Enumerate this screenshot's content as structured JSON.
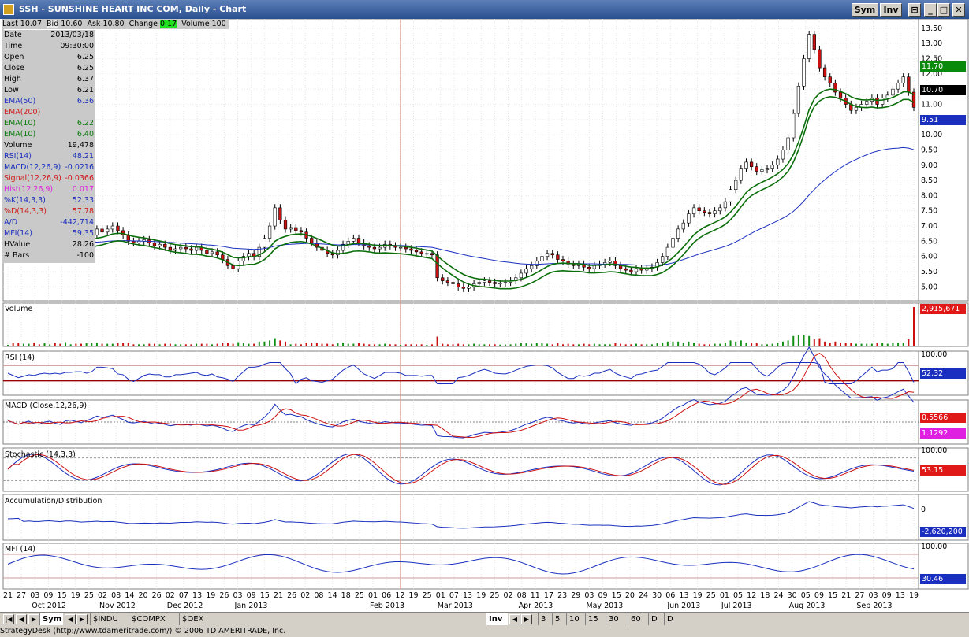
{
  "window": {
    "title": "SSH - SUNSHINE HEART INC COM, Daily - Chart",
    "sym_btn": "Sym",
    "inv_btn": "Inv"
  },
  "quote": {
    "last_label": "Last",
    "last": "10.07",
    "bid_label": "Bid",
    "bid": "10.60",
    "ask_label": "Ask",
    "ask": "10.80",
    "change_label": "Change",
    "change": "0.17",
    "volume_label": "Volume",
    "volume": "100"
  },
  "info_rows": [
    {
      "label": "Date",
      "value": "2013/03/18",
      "color": "#000000"
    },
    {
      "label": "Time",
      "value": "09:30:00",
      "color": "#000000"
    },
    {
      "label": "Open",
      "value": "6.25",
      "color": "#000000"
    },
    {
      "label": "Close",
      "value": "6.25",
      "color": "#000000"
    },
    {
      "label": "High",
      "value": "6.37",
      "color": "#000000"
    },
    {
      "label": "Low",
      "value": "6.21",
      "color": "#000000"
    },
    {
      "label": "EMA(50)",
      "value": "6.36",
      "color": "#1a2fbf"
    },
    {
      "label": "EMA(200)",
      "value": "",
      "color": "#d01818"
    },
    {
      "label": "EMA(10)",
      "value": "6.22",
      "color": "#0a7a0a"
    },
    {
      "label": "EMA(10)",
      "value": "6.40",
      "color": "#0a7a0a"
    },
    {
      "label": "Volume",
      "value": "19,478",
      "color": "#000000"
    },
    {
      "label": "RSI(14)",
      "value": "48.21",
      "color": "#1a2fbf"
    },
    {
      "label": "MACD(12,26,9)",
      "value": "-0.0216",
      "color": "#1a2fbf"
    },
    {
      "label": "Signal(12,26,9)",
      "value": "-0.0366",
      "color": "#d01818"
    },
    {
      "label": "Hist(12,26,9)",
      "value": "0.017",
      "color": "#e020e0"
    },
    {
      "label": "%K(14,3,3)",
      "value": "52.33",
      "color": "#1a2fbf"
    },
    {
      "label": "%D(14,3,3)",
      "value": "57.78",
      "color": "#d01818"
    },
    {
      "label": "A/D",
      "value": "-442,714",
      "color": "#1a2fbf"
    },
    {
      "label": "MFI(14)",
      "value": "59.35",
      "color": "#1a2fbf"
    },
    {
      "label": "HValue",
      "value": "28.26",
      "color": "#000000"
    },
    {
      "label": "# Bars",
      "value": "-100",
      "color": "#000000"
    }
  ],
  "panels": {
    "volume_label": "Volume",
    "rsi_label": "RSI (14)",
    "macd_label": "MACD (Close,12,26,9)",
    "stoch_label": "Stochastic (14,3,3)",
    "ad_label": "Accumulation/Distribution",
    "mfi_label": "MFI (14)"
  },
  "value_tags": {
    "price_1": "11.70",
    "price_2": "10.70",
    "ema50": "9.51",
    "volume": "2,915,671",
    "rsi": "52.32",
    "macd": "0.5566",
    "signal": "1.1292",
    "stoch": "53.15",
    "ad": "-2,620,200",
    "mfi": "30.46"
  },
  "colors": {
    "price_1_bg": "#0a8a0a",
    "price_2_bg": "#000000",
    "ema50_bg": "#1a2fbf",
    "volume_bg": "#e01818",
    "rsi_bg": "#1a2fbf",
    "macd_bg": "#e01818",
    "signal_bg": "#e020e0",
    "stoch_bg": "#e01818",
    "ad_bg": "#1a2fbf",
    "mfi_bg": "#1a2fbf",
    "up_candle": "#ffffff",
    "down_candle": "#cc1010",
    "ema50": "#1a2fbf",
    "ema10": "#0a6e0a",
    "vol_up": "#109010",
    "vol_down": "#cc1010",
    "cursor": "#e05050"
  },
  "tabs": {
    "sym": "Sym",
    "t1": "$INDU",
    "t2": "$COMPX",
    "t3": "$OEX",
    "inv": "Inv",
    "p1": "3",
    "p2": "5",
    "p3": "10",
    "p4": "15",
    "p5": "30",
    "p6": "60",
    "p7": "D",
    "p8": "D"
  },
  "status": "StrategyDesk (http://www.tdameritrade.com/)  © 2006 TD AMERITRADE, Inc.",
  "chart_data": {
    "type": "line",
    "title": "SSH - SUNSHINE HEART INC COM, Daily - Chart",
    "xlabel": "",
    "ylabel": "",
    "ylim": [
      4.75,
      13.6
    ],
    "y_ticks": [
      "13.50",
      "13.00",
      "12.50",
      "12.00",
      "11.50",
      "11.00",
      "10.50",
      "10.00",
      "9.50",
      "9.00",
      "8.50",
      "8.00",
      "7.50",
      "7.00",
      "6.50",
      "6.00",
      "5.50",
      "5.00"
    ],
    "day_ticks": [
      "21",
      "27",
      "03",
      "09",
      "15",
      "19",
      "25",
      "02",
      "08",
      "14",
      "20",
      "26",
      "02",
      "07",
      "13",
      "19",
      "26",
      "03",
      "09",
      "15",
      "21",
      "26",
      "02",
      "08",
      "14",
      "18",
      "25",
      "01",
      "06",
      "12",
      "19",
      "25",
      "01",
      "07",
      "13",
      "19",
      "25",
      "02",
      "08",
      "11",
      "17",
      "23",
      "29",
      "03",
      "09",
      "15",
      "20",
      "24",
      "30",
      "06",
      "13",
      "19",
      "25",
      "01",
      "05",
      "12",
      "18",
      "24",
      "30",
      "05",
      "09",
      "15",
      "21",
      "27",
      "03",
      "09",
      "13",
      "19"
    ],
    "month_labels": [
      "Oct 2012",
      "Nov 2012",
      "Dec 2012",
      "Jan 2013",
      "Feb 2013",
      "Mar 2013",
      "Apr 2013",
      "May 2013",
      "Jun 2013",
      "Jul 2013",
      "Aug 2013",
      "Sep 2013"
    ],
    "month_tick_index": [
      2,
      7,
      12,
      17,
      27,
      32,
      38,
      43,
      49,
      53,
      58,
      63
    ],
    "price_close": [
      6.7,
      6.55,
      6.4,
      6.5,
      6.6,
      6.4,
      6.35,
      6.5,
      6.55,
      6.4,
      6.3,
      6.55,
      6.6,
      6.5,
      6.4,
      6.55,
      6.7,
      6.9,
      6.8,
      6.9,
      7.0,
      6.85,
      6.7,
      6.5,
      6.45,
      6.5,
      6.55,
      6.45,
      6.35,
      6.4,
      6.3,
      6.2,
      6.25,
      6.3,
      6.25,
      6.2,
      6.3,
      6.2,
      6.1,
      6.15,
      6.05,
      5.9,
      5.7,
      5.6,
      5.85,
      6.0,
      6.1,
      6.0,
      6.3,
      6.6,
      7.0,
      7.6,
      7.2,
      6.9,
      6.95,
      6.85,
      6.8,
      6.6,
      6.45,
      6.3,
      6.2,
      6.1,
      6.05,
      6.2,
      6.4,
      6.5,
      6.6,
      6.45,
      6.35,
      6.3,
      6.25,
      6.3,
      6.4,
      6.35,
      6.3,
      6.3,
      6.25,
      6.2,
      6.15,
      6.1,
      6.1,
      6.05,
      5.3,
      5.2,
      5.15,
      5.1,
      5.0,
      4.95,
      5.0,
      5.1,
      5.15,
      5.2,
      5.15,
      5.1,
      5.12,
      5.15,
      5.2,
      5.3,
      5.45,
      5.6,
      5.7,
      5.85,
      6.0,
      6.1,
      6.05,
      5.9,
      5.85,
      5.75,
      5.7,
      5.75,
      5.65,
      5.6,
      5.7,
      5.75,
      5.8,
      5.85,
      5.7,
      5.6,
      5.55,
      5.5,
      5.6,
      5.55,
      5.6,
      5.65,
      5.8,
      6.0,
      6.3,
      6.6,
      6.9,
      7.1,
      7.4,
      7.6,
      7.5,
      7.45,
      7.4,
      7.5,
      7.6,
      7.8,
      8.2,
      8.5,
      8.9,
      9.1,
      8.95,
      8.8,
      8.85,
      8.9,
      9.0,
      9.2,
      9.5,
      9.9,
      10.7,
      11.6,
      12.5,
      13.3,
      12.8,
      12.2,
      11.9,
      11.7,
      11.4,
      11.2,
      11.0,
      10.8,
      10.9,
      11.0,
      11.1,
      11.2,
      11.0,
      11.2,
      11.3,
      11.5,
      11.7,
      11.9,
      11.4,
      10.9
    ],
    "ema50": [
      6.6,
      6.58,
      6.55,
      6.54,
      6.53,
      6.52,
      6.5,
      6.5,
      6.49,
      6.48,
      6.47,
      6.47,
      6.47,
      6.46,
      6.45,
      6.45,
      6.46,
      6.47,
      6.48,
      6.5,
      6.51,
      6.52,
      6.52,
      6.52,
      6.51,
      6.51,
      6.5,
      6.5,
      6.49,
      6.48,
      6.47,
      6.46,
      6.45,
      6.44,
      6.43,
      6.42,
      6.41,
      6.4,
      6.38,
      6.37,
      6.35,
      6.33,
      6.3,
      6.27,
      6.26,
      6.25,
      6.24,
      6.23,
      6.24,
      6.26,
      6.29,
      6.34,
      6.37,
      6.39,
      6.4,
      6.41,
      6.42,
      6.43,
      6.43,
      6.42,
      6.41,
      6.4,
      6.39,
      6.38,
      6.38,
      6.38,
      6.39,
      6.39,
      6.38,
      6.38,
      6.38,
      6.37,
      6.37,
      6.37,
      6.36,
      6.36,
      6.35,
      6.34,
      6.33,
      6.32,
      6.31,
      6.3,
      6.26,
      6.22,
      6.18,
      6.14,
      6.1,
      6.06,
      6.02,
      5.99,
      5.96,
      5.93,
      5.9,
      5.87,
      5.84,
      5.82,
      5.8,
      5.78,
      5.76,
      5.75,
      5.74,
      5.74,
      5.75,
      5.76,
      5.77,
      5.77,
      5.77,
      5.77,
      5.77,
      5.77,
      5.76,
      5.76,
      5.76,
      5.75,
      5.75,
      5.75,
      5.75,
      5.74,
      5.74,
      5.73,
      5.72,
      5.72,
      5.71,
      5.71,
      5.72,
      5.73,
      5.75,
      5.79,
      5.84,
      5.9,
      5.96,
      6.02,
      6.08,
      6.13,
      6.18,
      6.23,
      6.28,
      6.33,
      6.4,
      6.48,
      6.57,
      6.67,
      6.76,
      6.85,
      6.93,
      7.01,
      7.09,
      7.17,
      7.26,
      7.36,
      7.48,
      7.64,
      7.82,
      8.02,
      8.2,
      8.37,
      8.52,
      8.66,
      8.79,
      8.91,
      9.02,
      9.11,
      9.19,
      9.27,
      9.34,
      9.41,
      9.46,
      9.5,
      9.53,
      9.55,
      9.56,
      9.58,
      9.56,
      9.51
    ],
    "ema10_fast": [
      6.6,
      6.59,
      6.56,
      6.55,
      6.56,
      6.53,
      6.5,
      6.5,
      6.51,
      6.49,
      6.46,
      6.48,
      6.5,
      6.5,
      6.48,
      6.49,
      6.53,
      6.6,
      6.63,
      6.68,
      6.74,
      6.76,
      6.75,
      6.7,
      6.66,
      6.63,
      6.61,
      6.58,
      6.54,
      6.51,
      6.47,
      6.42,
      6.39,
      6.37,
      6.35,
      6.32,
      6.32,
      6.3,
      6.26,
      6.24,
      6.2,
      6.14,
      6.06,
      5.97,
      5.95,
      5.96,
      5.99,
      5.99,
      6.05,
      6.15,
      6.3,
      6.5,
      6.6,
      6.66,
      6.71,
      6.73,
      6.74,
      6.71,
      6.66,
      6.59,
      6.52,
      6.44,
      6.37,
      6.34,
      6.35,
      6.38,
      6.42,
      6.43,
      6.42,
      6.4,
      6.37,
      6.36,
      6.37,
      6.36,
      6.35,
      6.34,
      6.32,
      6.3,
      6.27,
      6.24,
      6.21,
      6.18,
      6.02,
      5.87,
      5.74,
      5.62,
      5.51,
      5.41,
      5.34,
      5.29,
      5.26,
      5.25,
      5.23,
      5.21,
      5.19,
      5.19,
      5.19,
      5.21,
      5.25,
      5.31,
      5.38,
      5.47,
      5.57,
      5.67,
      5.74,
      5.77,
      5.78,
      5.77,
      5.76,
      5.76,
      5.74,
      5.71,
      5.71,
      5.72,
      5.73,
      5.75,
      5.74,
      5.71,
      5.68,
      5.65,
      5.64,
      5.62,
      5.62,
      5.62,
      5.66,
      5.72,
      5.83,
      5.96,
      6.13,
      6.31,
      6.51,
      6.71,
      6.85,
      6.96,
      7.04,
      7.12,
      7.2,
      7.3,
      7.46,
      7.65,
      7.88,
      8.1,
      8.25,
      8.35,
      8.44,
      8.52,
      8.61,
      8.72,
      8.86,
      9.05,
      9.35,
      9.76,
      10.26,
      10.82,
      11.18,
      11.36,
      11.46,
      11.5,
      11.48,
      11.42,
      11.35,
      11.25,
      11.18,
      11.15,
      11.14,
      11.16,
      11.13,
      11.14,
      11.17,
      11.23,
      11.31,
      11.41,
      11.41,
      11.31
    ]
  }
}
